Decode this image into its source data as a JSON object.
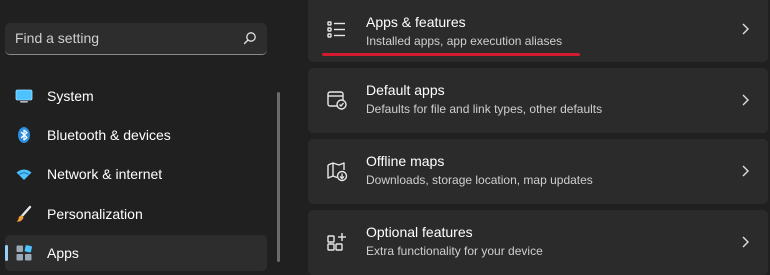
{
  "search": {
    "placeholder": "Find a setting"
  },
  "sidebar": {
    "items": [
      {
        "label": "System",
        "icon": "monitor-icon"
      },
      {
        "label": "Bluetooth & devices",
        "icon": "bluetooth-icon"
      },
      {
        "label": "Network & internet",
        "icon": "wifi-icon"
      },
      {
        "label": "Personalization",
        "icon": "paintbrush-icon"
      },
      {
        "label": "Apps",
        "icon": "apps-icon",
        "selected": true
      }
    ]
  },
  "main": {
    "cards": [
      {
        "title": "Apps & features",
        "subtitle": "Installed apps, app execution aliases",
        "icon": "list-icon",
        "highlighted": true
      },
      {
        "title": "Default apps",
        "subtitle": "Defaults for file and link types, other defaults",
        "icon": "default-apps-icon"
      },
      {
        "title": "Offline maps",
        "subtitle": "Downloads, storage location, map updates",
        "icon": "map-download-icon"
      },
      {
        "title": "Optional features",
        "subtitle": "Extra functionality for your device",
        "icon": "optional-features-icon"
      }
    ]
  },
  "colors": {
    "accent": "#9ad0f5",
    "annotation": "#d21b2d",
    "card": "#2b2b2b",
    "background": "#202020"
  }
}
